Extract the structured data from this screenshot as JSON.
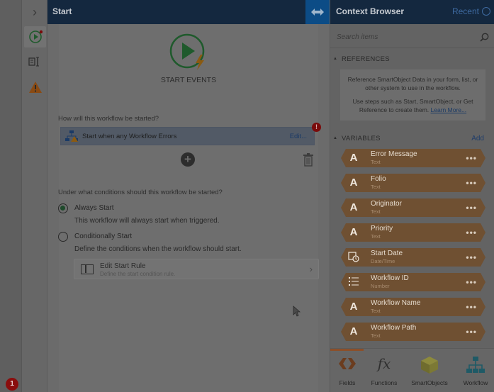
{
  "notification_count": "1",
  "designer": {
    "title": "Start",
    "start_label": "START EVENTS",
    "question_start": "How will this workflow be started?",
    "event": {
      "label": "Start when any Workflow Errors",
      "edit_label": "Edit...",
      "error_count": "!"
    },
    "question_conditions": "Under what conditions should this workflow be started?",
    "options": [
      {
        "label": "Always Start",
        "description": "This workflow will always start when triggered.",
        "selected": true
      },
      {
        "label": "Conditionally Start",
        "description": "Define the conditions when the workflow should start.",
        "selected": false
      }
    ],
    "rule": {
      "title": "Edit Start Rule",
      "subtitle": "Define the start condition rule."
    }
  },
  "context_browser": {
    "title": "Context Browser",
    "recent_label": "Recent",
    "search_placeholder": "Search items",
    "references_heading": "REFERENCES",
    "references_text_1": "Reference SmartObject Data in your form, list, or other system to use in the workflow.",
    "references_text_2": "Use steps such as Start, SmartObject, or Get Reference to create them.",
    "learn_more": "Learn More...",
    "variables_heading": "VARIABLES",
    "add_label": "Add",
    "variables": [
      {
        "name": "Error Message",
        "type": "Text",
        "icon": "A"
      },
      {
        "name": "Folio",
        "type": "Text",
        "icon": "A"
      },
      {
        "name": "Originator",
        "type": "Text",
        "icon": "A"
      },
      {
        "name": "Priority",
        "type": "Text",
        "icon": "A"
      },
      {
        "name": "Start Date",
        "type": "Date/Time",
        "icon": "calendar-clock-icon"
      },
      {
        "name": "Workflow ID",
        "type": "Number",
        "icon": "number-list-icon"
      },
      {
        "name": "Workflow Name",
        "type": "Text",
        "icon": "A"
      },
      {
        "name": "Workflow Path",
        "type": "Text",
        "icon": "A"
      }
    ],
    "tabs": [
      {
        "label": "Fields",
        "icon": "fields-icon"
      },
      {
        "label": "Functions",
        "icon": "fx-icon"
      },
      {
        "label": "SmartObjects",
        "icon": "cube-icon"
      },
      {
        "label": "Workflow",
        "icon": "org-chart-icon"
      }
    ]
  },
  "colors": {
    "header": "#14283f",
    "accent_blue": "#0c4c86",
    "variable_brown": "#6f5032",
    "start_green": "#1f5a2c"
  }
}
